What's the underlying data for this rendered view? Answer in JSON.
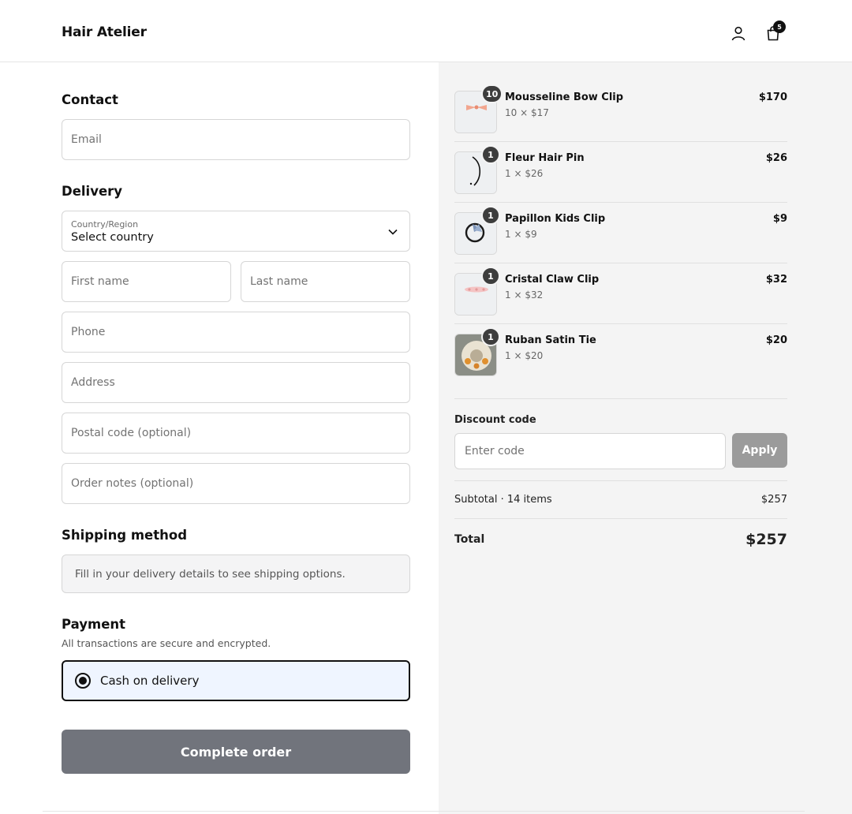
{
  "header": {
    "brand": "Hair Atelier",
    "cart_count": "5"
  },
  "contact": {
    "title": "Contact",
    "email_placeholder": "Email"
  },
  "delivery": {
    "title": "Delivery",
    "country_label": "Country/Region",
    "country_value": "Select country",
    "first_name_placeholder": "First name",
    "last_name_placeholder": "Last name",
    "phone_placeholder": "Phone",
    "address_placeholder": "Address",
    "postal_placeholder": "Postal code (optional)",
    "notes_placeholder": "Order notes (optional)"
  },
  "shipping": {
    "title": "Shipping method",
    "info": "Fill in your delivery details to see shipping options."
  },
  "payment": {
    "title": "Payment",
    "subtitle": "All transactions are secure and encrypted.",
    "option": "Cash on delivery"
  },
  "complete_button": "Complete order",
  "items": [
    {
      "name": "Mousseline Bow Clip",
      "qty": "10",
      "unit": "10 × $17",
      "price": "$170"
    },
    {
      "name": "Fleur Hair Pin",
      "qty": "1",
      "unit": "1 × $26",
      "price": "$26"
    },
    {
      "name": "Papillon Kids Clip",
      "qty": "1",
      "unit": "1 × $9",
      "price": "$9"
    },
    {
      "name": "Cristal Claw Clip",
      "qty": "1",
      "unit": "1 × $32",
      "price": "$32"
    },
    {
      "name": "Ruban Satin Tie",
      "qty": "1",
      "unit": "1 × $20",
      "price": "$20"
    }
  ],
  "discount": {
    "label": "Discount code",
    "placeholder": "Enter code",
    "apply": "Apply"
  },
  "summary": {
    "subtotal_label": "Subtotal · 14 items",
    "subtotal_value": "$257",
    "total_label": "Total",
    "total_value": "$257"
  }
}
